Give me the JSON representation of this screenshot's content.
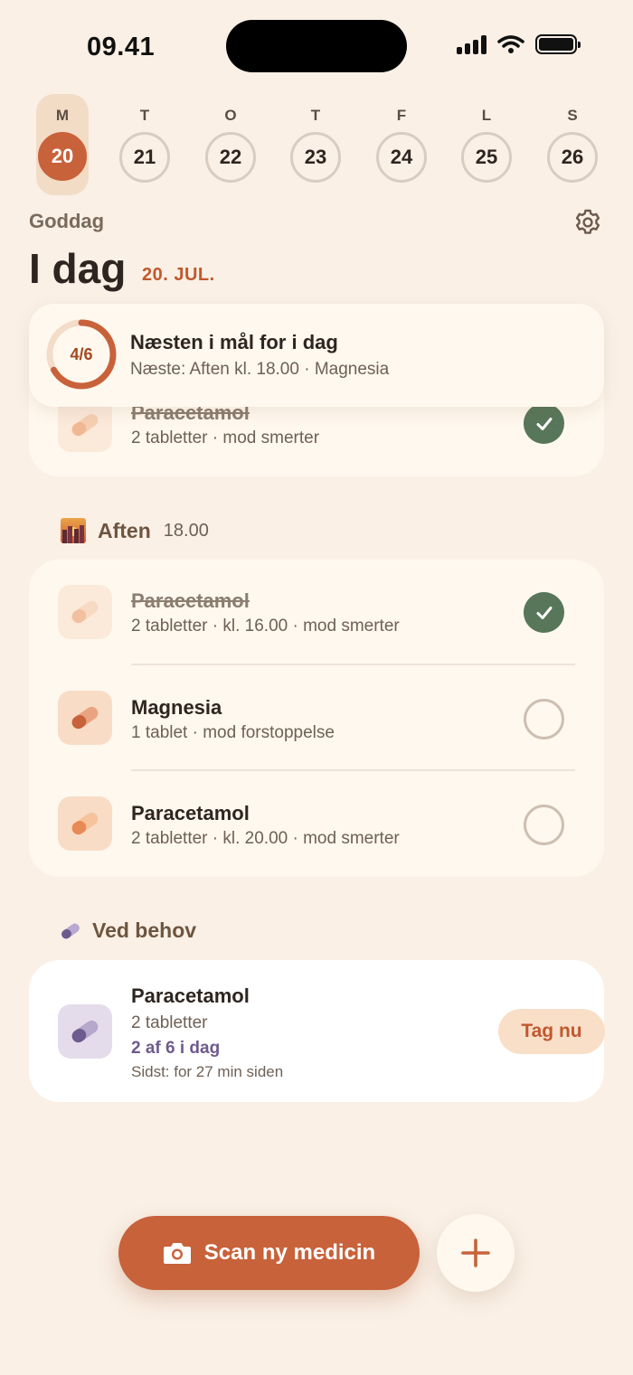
{
  "status_bar": {
    "time": "09.41"
  },
  "week": {
    "days": [
      {
        "letter": "M",
        "number": "20",
        "selected": true
      },
      {
        "letter": "T",
        "number": "21"
      },
      {
        "letter": "O",
        "number": "22"
      },
      {
        "letter": "T",
        "number": "23"
      },
      {
        "letter": "F",
        "number": "24"
      },
      {
        "letter": "L",
        "number": "25"
      },
      {
        "letter": "S",
        "number": "26"
      }
    ]
  },
  "header": {
    "greeting": "Goddag",
    "title": "I dag",
    "date": "20. JUL."
  },
  "summary": {
    "progress_label": "4/6",
    "progress_fraction": 0.667,
    "title": "Næsten i mål for i dag",
    "subtitle": "Næste: Aften kl. 18.00 · Magnesia"
  },
  "previous_card": {
    "name": "Paracetamol",
    "detail": "2 tabletter · mod smerter",
    "taken": true
  },
  "evening": {
    "title": "Aften",
    "time": "18.00",
    "items": [
      {
        "name": "Paracetamol",
        "detail": "2 tabletter · kl. 16.00 · mod smerter",
        "taken": true
      },
      {
        "name": "Magnesia",
        "detail": "1 tablet · mod forstoppelse",
        "taken": false
      },
      {
        "name": "Paracetamol",
        "detail": "2 tabletter · kl. 20.00 · mod smerter",
        "taken": false
      }
    ]
  },
  "as_needed": {
    "title": "Ved behov",
    "item": {
      "name": "Paracetamol",
      "detail": "2 tabletter",
      "count": "2 af 6 i dag",
      "last": "Sidst: for 27 min siden",
      "button": "Tag nu"
    }
  },
  "actions": {
    "scan_label": "Scan ny medicin"
  },
  "colors": {
    "accent": "#C8623A",
    "done": "#58775A",
    "background": "#FAF0E6",
    "as_needed": "#6E5A8E"
  }
}
